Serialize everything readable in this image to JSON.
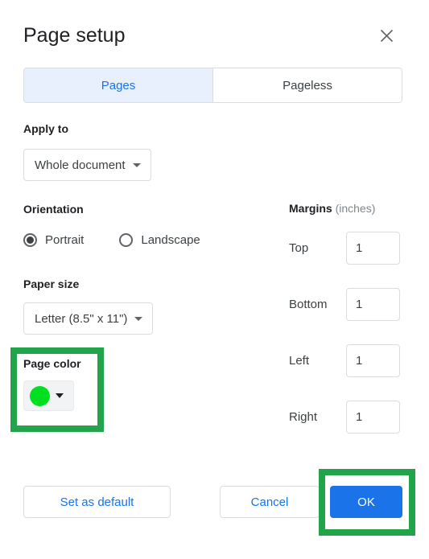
{
  "dialog": {
    "title": "Page setup",
    "close_icon": "close-icon"
  },
  "tabs": [
    {
      "label": "Pages",
      "active": true
    },
    {
      "label": "Pageless",
      "active": false
    }
  ],
  "apply_to": {
    "label": "Apply to",
    "value": "Whole document"
  },
  "orientation": {
    "label": "Orientation",
    "options": [
      {
        "label": "Portrait",
        "selected": true
      },
      {
        "label": "Landscape",
        "selected": false
      }
    ]
  },
  "paper_size": {
    "label": "Paper size",
    "value": "Letter (8.5\" x 11\")"
  },
  "page_color": {
    "label": "Page color",
    "swatch_color": "#00e020"
  },
  "margins": {
    "title": "Margins",
    "unit": "(inches)",
    "fields": [
      {
        "label": "Top",
        "value": "1"
      },
      {
        "label": "Bottom",
        "value": "1"
      },
      {
        "label": "Left",
        "value": "1"
      },
      {
        "label": "Right",
        "value": "1"
      }
    ]
  },
  "footer": {
    "set_as_default": "Set as default",
    "cancel": "Cancel",
    "ok": "OK"
  },
  "annotations": {
    "highlight_color": "#22a54a",
    "targets": [
      "page-color-control",
      "ok-button"
    ]
  }
}
